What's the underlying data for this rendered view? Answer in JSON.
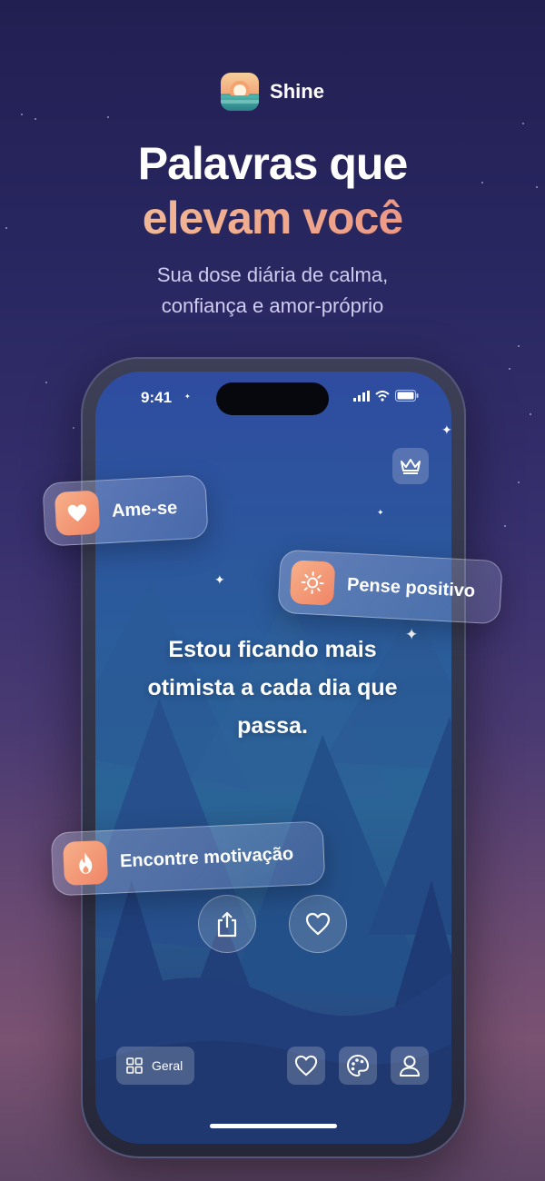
{
  "brand": {
    "name": "Shine"
  },
  "headline": {
    "line1": "Palavras que",
    "line2": "elevam você"
  },
  "subtitle": {
    "line1": "Sua dose diária de calma,",
    "line2": "confiança e amor-próprio"
  },
  "phone": {
    "status": {
      "time": "9:41"
    },
    "quote": "Estou ficando mais otimista a cada dia que passa.",
    "category_label": "Geral"
  },
  "chips": {
    "love": "Ame-se",
    "positive": "Pense positivo",
    "motivation": "Encontre motivação"
  },
  "colors": {
    "accent_start": "#f4c79b",
    "accent_end": "#e9857e",
    "icon_orange": "#ef8566"
  }
}
